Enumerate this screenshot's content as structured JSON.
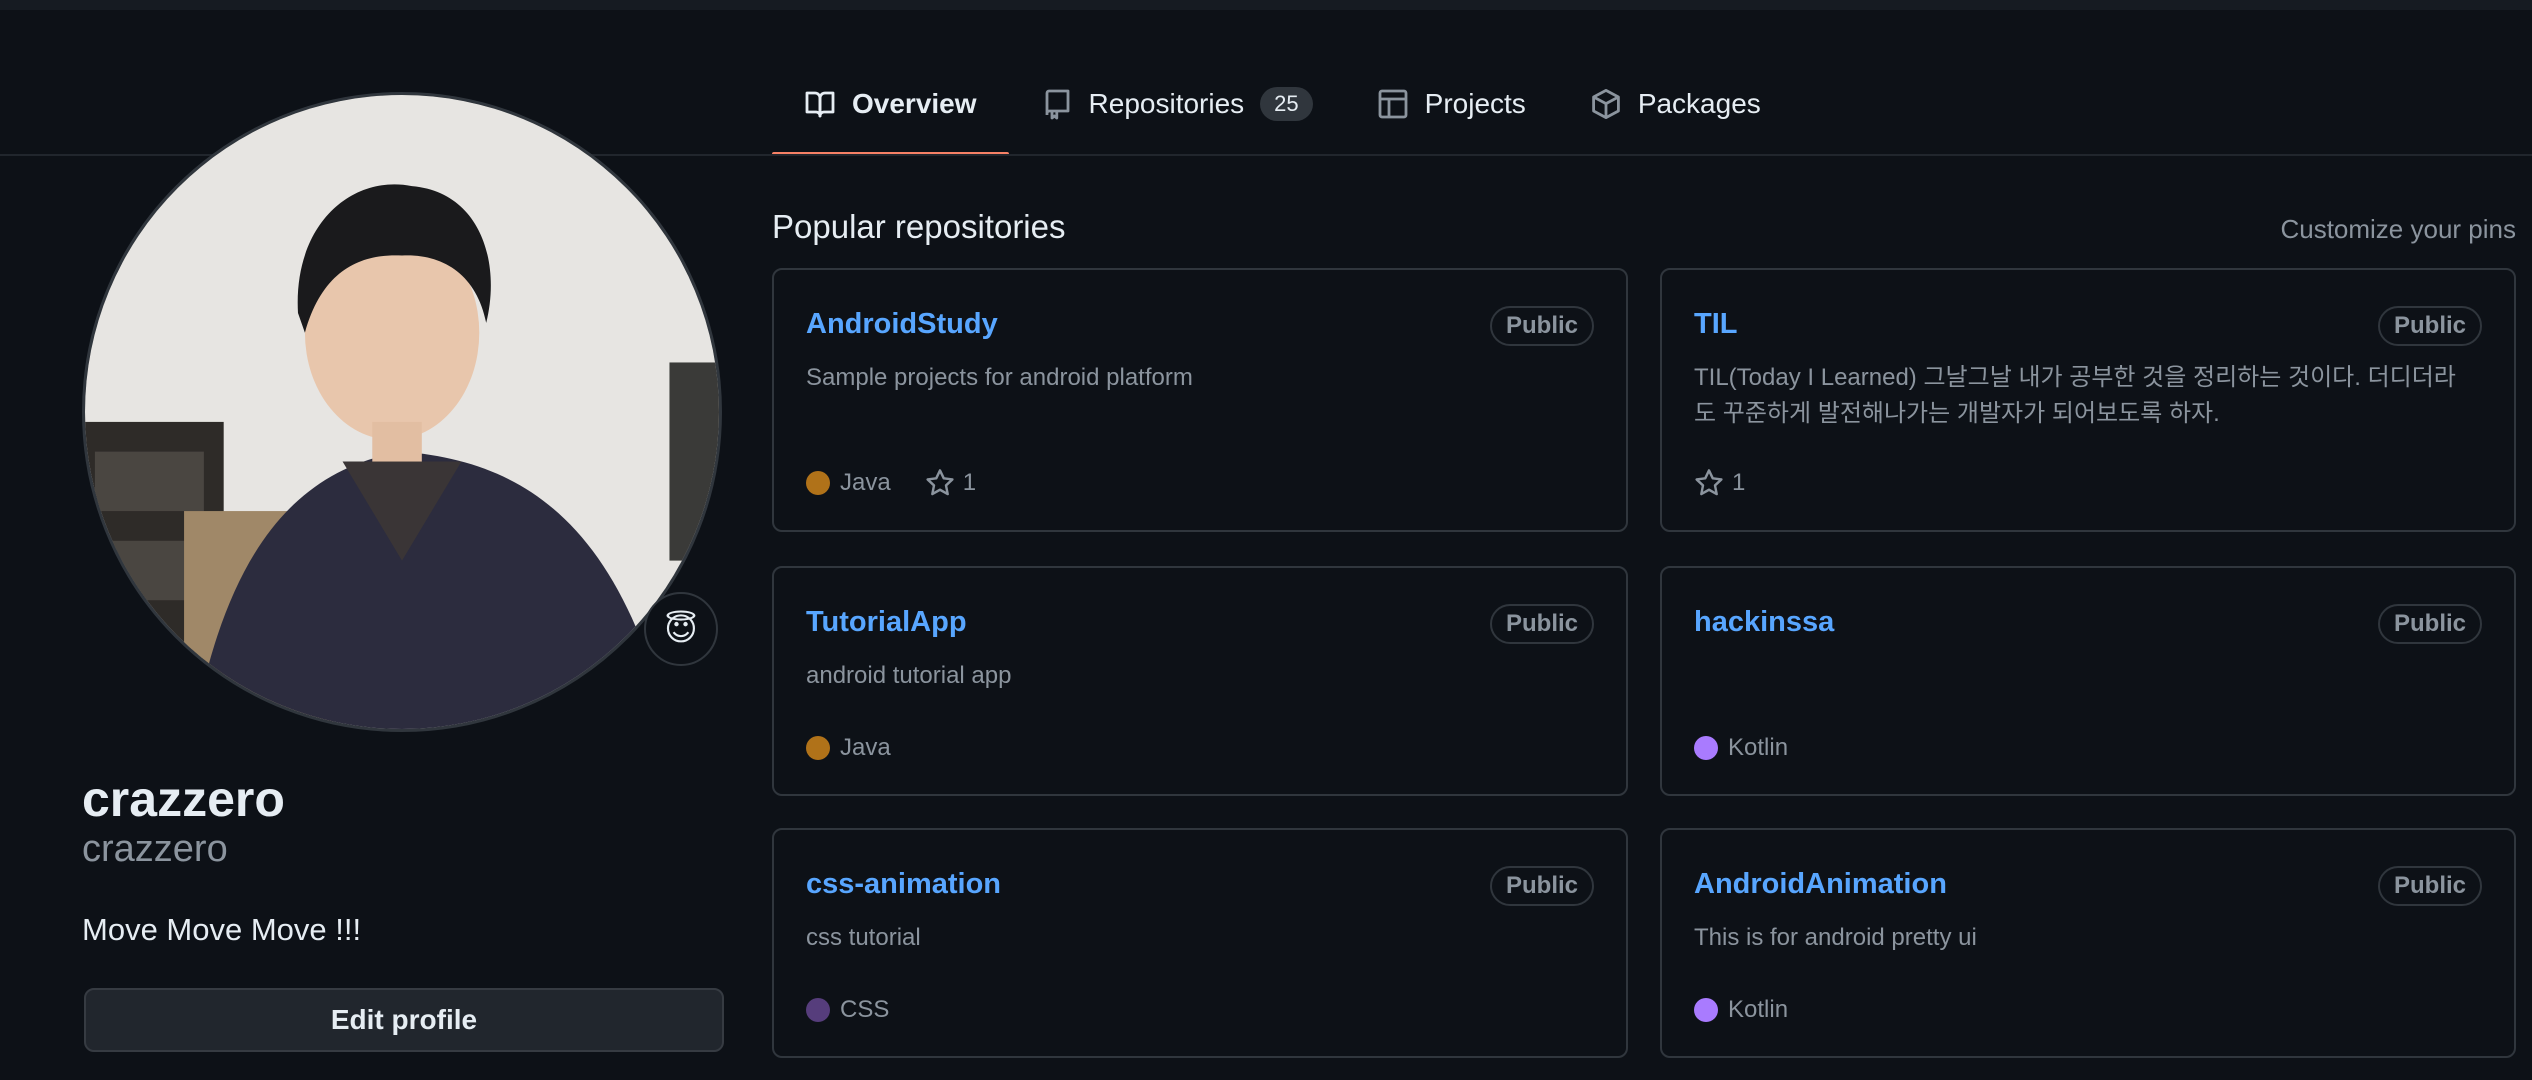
{
  "tabs": [
    {
      "label": "Overview",
      "icon": "book-icon",
      "selected": true
    },
    {
      "label": "Repositories",
      "icon": "repo-icon",
      "count": "25"
    },
    {
      "label": "Projects",
      "icon": "table-icon"
    },
    {
      "label": "Packages",
      "icon": "package-icon"
    }
  ],
  "profile": {
    "full_name": "crazzero",
    "username": "crazzero",
    "bio": "Move Move Move !!!",
    "edit_label": "Edit profile",
    "status_emoji": "😇"
  },
  "pinned": {
    "title": "Popular repositories",
    "customize_label": "Customize your pins",
    "repos": [
      {
        "name": "AndroidStudy",
        "visibility": "Public",
        "description": "Sample projects for android platform",
        "language": "Java",
        "lang_color": "#b07219",
        "stars": "1"
      },
      {
        "name": "TIL",
        "visibility": "Public",
        "description": "TIL(Today I Learned) 그날그날 내가 공부한 것을 정리하는 것이다. 더디더라도 꾸준하게 발전해나가는 개발자가 되어보도록 하자.",
        "stars": "1"
      },
      {
        "name": "TutorialApp",
        "visibility": "Public",
        "description": "android tutorial app",
        "language": "Java",
        "lang_color": "#b07219"
      },
      {
        "name": "hackinssa",
        "visibility": "Public",
        "description": "",
        "language": "Kotlin",
        "lang_color": "#A97BFF"
      },
      {
        "name": "css-animation",
        "visibility": "Public",
        "description": "css tutorial",
        "language": "CSS",
        "lang_color": "#563d7c"
      },
      {
        "name": "AndroidAnimation",
        "visibility": "Public",
        "description": "This is for android pretty ui",
        "language": "Kotlin",
        "lang_color": "#A97BFF"
      }
    ]
  }
}
